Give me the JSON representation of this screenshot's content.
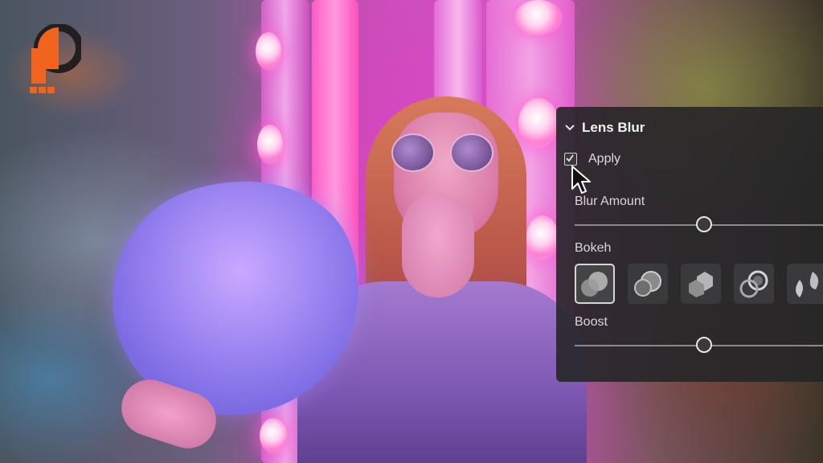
{
  "panel": {
    "title": "Lens Blur",
    "apply": {
      "label": "Apply",
      "checked": true
    },
    "blur_amount": {
      "label": "Blur Amount",
      "value": 0.52
    },
    "bokeh": {
      "label": "Bokeh",
      "options": [
        {
          "icon": "bokeh-circle-icon",
          "selected": true
        },
        {
          "icon": "bokeh-bubble-icon",
          "selected": false
        },
        {
          "icon": "bokeh-blade-icon",
          "selected": false
        },
        {
          "icon": "bokeh-ring-icon",
          "selected": false
        },
        {
          "icon": "bokeh-cat-eye-icon",
          "selected": false
        }
      ]
    },
    "boost": {
      "label": "Boost",
      "value": 0.52
    }
  },
  "colors": {
    "panel_bg": "#262628",
    "logo_orange": "#f0641e",
    "logo_dark": "#231f20"
  }
}
